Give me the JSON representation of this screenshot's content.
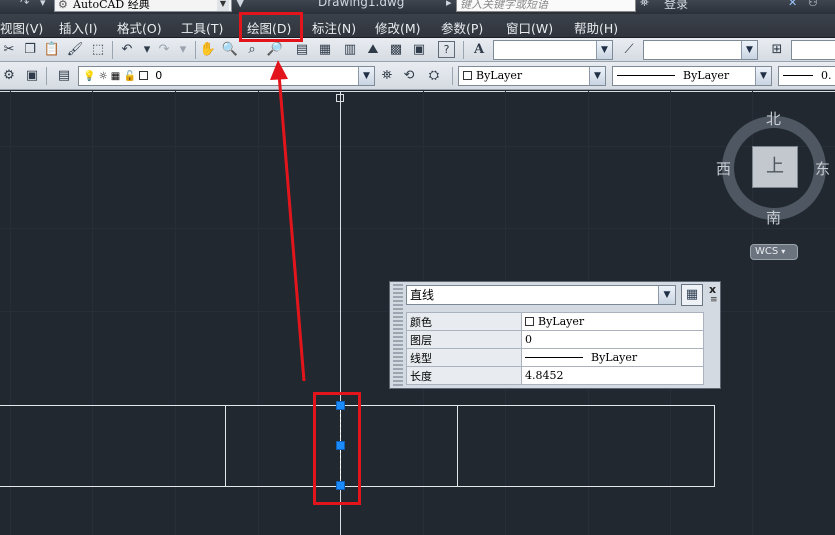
{
  "titlebar": {
    "workspace": "AutoCAD 经典",
    "document_title": "Drawing1.dwg",
    "search_placeholder": "键入关键字或短语",
    "login": "登录"
  },
  "menu": {
    "items": [
      {
        "label": "视图(V)"
      },
      {
        "label": "插入(I)"
      },
      {
        "label": "格式(O)"
      },
      {
        "label": "工具(T)"
      },
      {
        "label": "绘图(D)"
      },
      {
        "label": "标注(N)"
      },
      {
        "label": "修改(M)"
      },
      {
        "label": "参数(P)"
      },
      {
        "label": "窗口(W)"
      },
      {
        "label": "帮助(H)"
      }
    ],
    "highlighted_index": 4
  },
  "layers_toolbar": {
    "current_layer": "0"
  },
  "properties_toolbar": {
    "color": "ByLayer",
    "linetype": "ByLayer",
    "lineweight": "0."
  },
  "viewcube": {
    "top_face": "上",
    "north": "北",
    "south": "南",
    "east": "东",
    "west": "西",
    "ucs": "WCS"
  },
  "quick_properties": {
    "object_type": "直线",
    "rows": [
      {
        "key": "颜色",
        "value": "ByLayer"
      },
      {
        "key": "图层",
        "value": "0"
      },
      {
        "key": "线型",
        "value": "ByLayer"
      },
      {
        "key": "长度",
        "value": "4.8452"
      }
    ]
  },
  "colors": {
    "canvas": "#212830",
    "highlight": "#e3151c",
    "grip": "#1a8cff"
  }
}
